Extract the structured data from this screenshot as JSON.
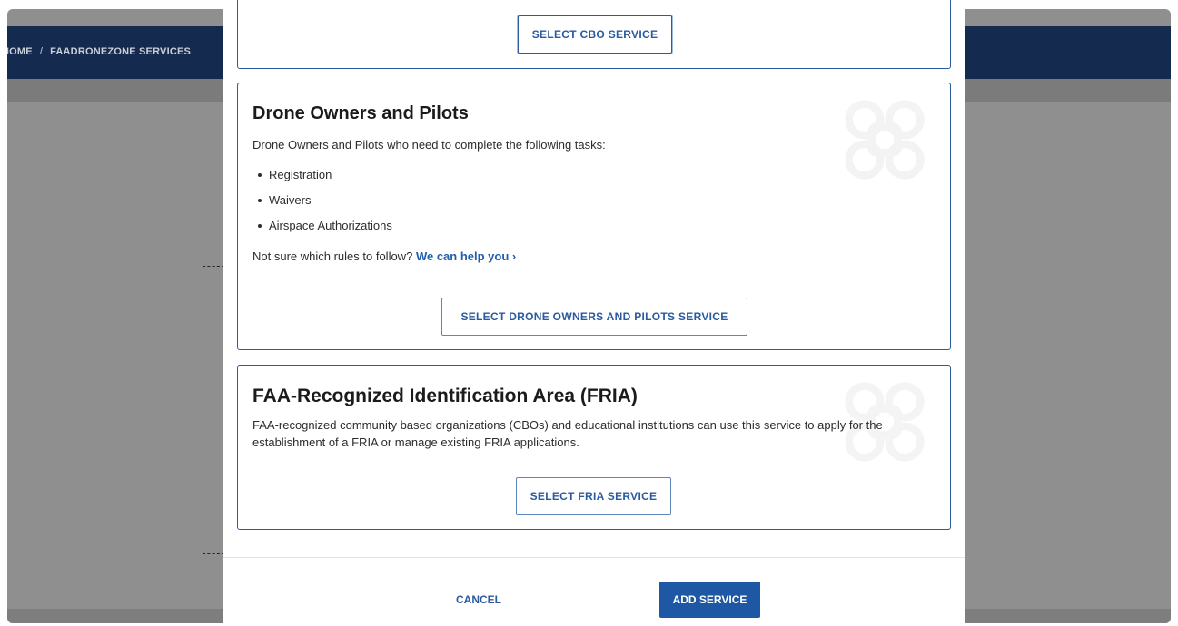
{
  "background": {
    "breadcrumb": {
      "home": "HOME",
      "separator": "/",
      "current": "FAADRONEZONE SERVICES"
    }
  },
  "modal": {
    "cbo_card": {
      "button_label": "SELECT CBO SERVICE"
    },
    "drone_card": {
      "title": "Drone Owners and Pilots",
      "description": "Drone Owners and Pilots who need to complete the following tasks:",
      "tasks": [
        "Registration",
        "Waivers",
        "Airspace Authorizations"
      ],
      "help_prefix": "Not sure which rules to follow?",
      "help_link": "We can help you ›",
      "button_label": "SELECT DRONE OWNERS AND PILOTS SERVICE",
      "icon": "drone-icon"
    },
    "fria_card": {
      "title": "FAA-Recognized Identification Area (FRIA)",
      "description": "FAA-recognized community based organizations (CBOs) and educational institutions can use this service to apply for the establishment of a FRIA or manage existing FRIA applications.",
      "button_label": "SELECT FRIA SERVICE",
      "icon": "drone-icon"
    },
    "footer": {
      "cancel_label": "CANCEL",
      "add_label": "ADD SERVICE"
    }
  },
  "colors": {
    "primary": "#1e57a4",
    "card_border": "#2a5a9f",
    "nav_background": "#142a4e",
    "overlay": "#8f8f8f"
  }
}
